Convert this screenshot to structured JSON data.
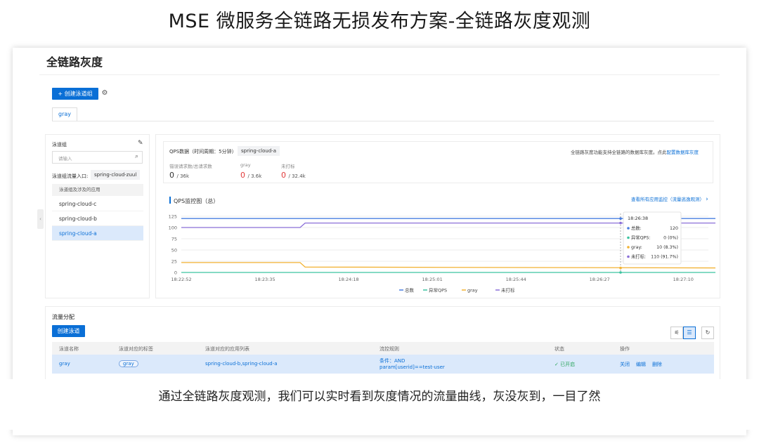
{
  "slide_title": "MSE 微服务全链路无损发布方案-全链路灰度观测",
  "page_title": "全链路灰度",
  "toolbar": {
    "create_lane_group": "+ 创建泳道组"
  },
  "tabs": [
    {
      "label": "gray"
    }
  ],
  "sidebar": {
    "title": "泳道组",
    "search_placeholder": "请输入",
    "entry_label": "泳道组流量入口:",
    "entry_value": "spring-cloud-zuul",
    "apps_header": "泳道组及涉及的应用",
    "items": [
      {
        "label": "spring-cloud-c"
      },
      {
        "label": "spring-cloud-b"
      },
      {
        "label": "spring-cloud-a"
      }
    ]
  },
  "qps": {
    "title": "QPS数据（时间周期：5分钟）",
    "app_chip": "spring-cloud-a",
    "note_prefix": "全链路灰度功能支持全链路的数据库灰度。点此",
    "note_link": "配置数据库灰度",
    "stats": [
      {
        "label": "错误请求数/总请求数",
        "num": "0",
        "den": "/ 36k"
      },
      {
        "label": "gray",
        "num": "0",
        "den": "/ 3.6k"
      },
      {
        "label": "未打标",
        "num": "0",
        "den": "/ 32.4k"
      }
    ],
    "monitor_title": "QPS监控图（总）",
    "monitor_link": "查看所有应用监控（流量逃逸观测）"
  },
  "chart_data": {
    "type": "line",
    "x": [
      "18:22:52",
      "18:23:35",
      "18:24:18",
      "18:25:01",
      "18:25:44",
      "18:26:27",
      "18:27:10"
    ],
    "yticks": [
      0,
      25,
      50,
      75,
      100,
      125
    ],
    "ylim": [
      0,
      125
    ],
    "series": [
      {
        "name": "总数",
        "color": "#4a7fe0",
        "points": [
          [
            0,
            120
          ],
          [
            1.5,
            120
          ],
          [
            5.2,
            120
          ],
          [
            6.6,
            120
          ]
        ]
      },
      {
        "name": "异常QPS",
        "color": "#3cc3a0",
        "points": [
          [
            0,
            0
          ],
          [
            6.6,
            0
          ]
        ]
      },
      {
        "name": "gray",
        "color": "#f2b233",
        "points": [
          [
            0,
            22
          ],
          [
            1.42,
            22
          ],
          [
            1.48,
            12
          ],
          [
            6.6,
            10
          ]
        ]
      },
      {
        "name": "未打标",
        "color": "#8a6fd8",
        "points": [
          [
            0,
            100
          ],
          [
            1.42,
            100
          ],
          [
            1.48,
            110
          ],
          [
            6.6,
            110
          ]
        ]
      }
    ],
    "legend_position": "bottom"
  },
  "tooltip": {
    "time": "18:26:38",
    "rows": [
      {
        "name": "总数:",
        "value": "120",
        "color": "#4a7fe0"
      },
      {
        "name": "异常QPS:",
        "value": "0 (0%)",
        "color": "#3cc3a0"
      },
      {
        "name": "gray:",
        "value": "10 (8.3%)",
        "color": "#f2b233"
      },
      {
        "name": "未打标:",
        "value": "110 (91.7%)",
        "color": "#8a6fd8"
      }
    ]
  },
  "traffic": {
    "title": "流量分配",
    "create_button": "创建泳道",
    "columns": [
      "泳道名称",
      "泳道对应的标签",
      "泳道对应的应用列表",
      "流控规则",
      "状态",
      "操作"
    ],
    "row": {
      "name": "gray",
      "tag": "gray",
      "apps": "spring-cloud-b,spring-cloud-a",
      "rule_line1": "条件：AND",
      "rule_line2": "param[userid]==test-user",
      "status": "✓ 已开启",
      "actions": [
        "关闭",
        "编辑",
        "删除"
      ]
    }
  },
  "caption": "通过全链路灰度观测，我们可以实时看到灰度情况的流量曲线，灰没灰到，一目了然"
}
